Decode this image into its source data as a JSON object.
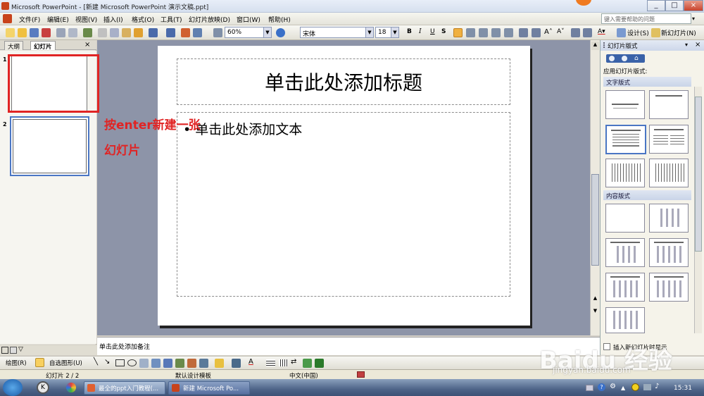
{
  "window": {
    "title": "Microsoft PowerPoint - [新建 Microsoft PowerPoint 演示文稿.ppt]",
    "minimize_label": "_",
    "maximize_label": "□",
    "close_label": "×"
  },
  "menu": {
    "items": [
      "文件(F)",
      "编辑(E)",
      "视图(V)",
      "插入(I)",
      "格式(O)",
      "工具(T)",
      "幻灯片放映(D)",
      "窗口(W)",
      "帮助(H)"
    ],
    "help_placeholder": "键入需要帮助的问题"
  },
  "toolbar": {
    "zoom": "60%",
    "font_name": "宋体",
    "font_size": "18",
    "bold": "B",
    "italic": "I",
    "underline": "U",
    "shadow": "S",
    "design_label": "设计(S)",
    "new_slide_label": "新幻灯片(N)"
  },
  "left_pane": {
    "tabs": [
      "大纲",
      "幻灯片"
    ],
    "close": "×",
    "slides": [
      {
        "number": "1"
      },
      {
        "number": "2"
      }
    ]
  },
  "slide": {
    "title_placeholder": "单击此处添加标题",
    "body_placeholder": "• 单击此处添加文本"
  },
  "notes": {
    "placeholder": "单击此处添加备注"
  },
  "task_pane": {
    "title": "幻灯片版式",
    "subtitle": "应用幻灯片版式:",
    "section_text": "文字版式",
    "section_content": "内容版式",
    "footer": "插入新幻灯片时显示"
  },
  "draw_toolbar": {
    "draw_label": "绘图(R)",
    "autoshape_label": "自选图形(U)"
  },
  "status": {
    "slide_pos": "幻灯片 2 / 2",
    "template": "默认设计模板",
    "language": "中文(中国)"
  },
  "taskbar": {
    "tasks": [
      "最全的ppt入门教程(...",
      "新建 Microsoft Po..."
    ],
    "time": "15:31"
  },
  "annotation": {
    "text": "按enter新建一张幻灯片"
  },
  "watermark": {
    "brand": "Baidu 经验",
    "url": "jingyan.baidu.com"
  },
  "colors": {
    "annotation": "#e02424",
    "selection": "#4a76c4"
  }
}
